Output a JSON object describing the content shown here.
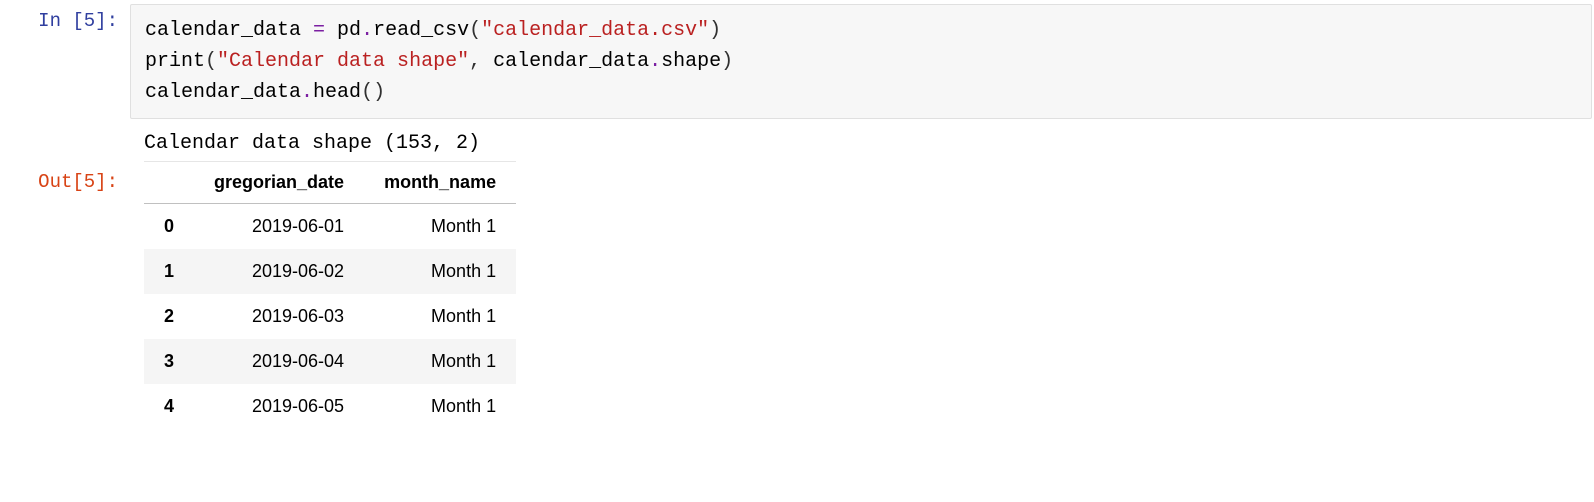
{
  "prompts": {
    "in_label": "In [5]:",
    "out_label": "Out[5]:"
  },
  "code": {
    "ln1_var": "calendar_data",
    "eq": " = ",
    "pd": "pd",
    "dot1": ".",
    "read_csv": "read_csv",
    "lp1": "(",
    "str_csv": "\"calendar_data.csv\"",
    "rp1": ")",
    "ln2_print": "print",
    "lp2": "(",
    "str_msg": "\"Calendar data shape\"",
    "comma": ", ",
    "cd2": "calendar_data",
    "dot2": ".",
    "shape": "shape",
    "rp2": ")",
    "cd3": "calendar_data",
    "dot3": ".",
    "head": "head",
    "lp3": "(",
    "rp3": ")"
  },
  "stdout": "Calendar data shape (153, 2)",
  "table": {
    "columns": [
      "gregorian_date",
      "month_name"
    ],
    "index": [
      "0",
      "1",
      "2",
      "3",
      "4"
    ],
    "rows": [
      [
        "2019-06-01",
        "Month 1"
      ],
      [
        "2019-06-02",
        "Month 1"
      ],
      [
        "2019-06-03",
        "Month 1"
      ],
      [
        "2019-06-04",
        "Month 1"
      ],
      [
        "2019-06-05",
        "Month 1"
      ]
    ]
  }
}
